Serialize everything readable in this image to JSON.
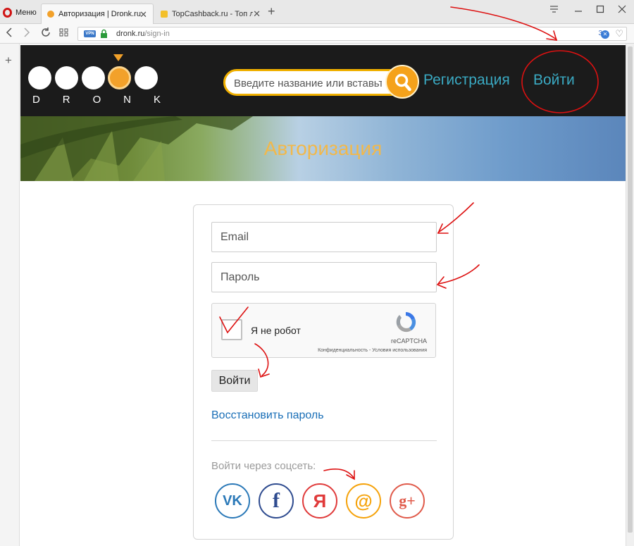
{
  "browser": {
    "menu_label": "Меню",
    "tabs": [
      {
        "title": "Авторизация | Dronk.ru",
        "close": "✕"
      },
      {
        "title": "TopCashback.ru - Топ лучш",
        "close": "✕"
      }
    ],
    "new_tab": "+",
    "url_domain": "dronk.ru",
    "url_path": "/sign-in",
    "vpn_label": "VPN",
    "extension_count": "3",
    "side_plus": "+"
  },
  "site": {
    "logo_letters": [
      "D",
      "R",
      "O",
      "N",
      "K"
    ],
    "search_placeholder": "Введите название или вставьте ссылку",
    "register_link": "Регистрация",
    "login_link": "Войти",
    "hero_title": "Авторизация"
  },
  "form": {
    "email_placeholder": "Email",
    "password_placeholder": "Пароль",
    "captcha_label": "Я не робот",
    "recaptcha_name": "reCAPTCHA",
    "recaptcha_links": "Конфиденциальность - Условия использования",
    "login_button": "Войти",
    "restore_link": "Восстановить пароль",
    "social_label": "Войти через соцсеть:",
    "social": [
      {
        "name": "vk",
        "glyph": "VK",
        "color": "#2b79b8"
      },
      {
        "name": "facebook",
        "glyph": "f",
        "color": "#2e4b8f"
      },
      {
        "name": "yandex",
        "glyph": "Я",
        "color": "#e03a3a"
      },
      {
        "name": "mail",
        "glyph": "@",
        "color": "#f5a20a"
      },
      {
        "name": "google-plus",
        "glyph": "g+",
        "color": "#e05a4a"
      }
    ]
  },
  "colors": {
    "accent_orange": "#f2a12a",
    "link_teal": "#3aa9c2",
    "annotation_red": "#dd1111"
  }
}
